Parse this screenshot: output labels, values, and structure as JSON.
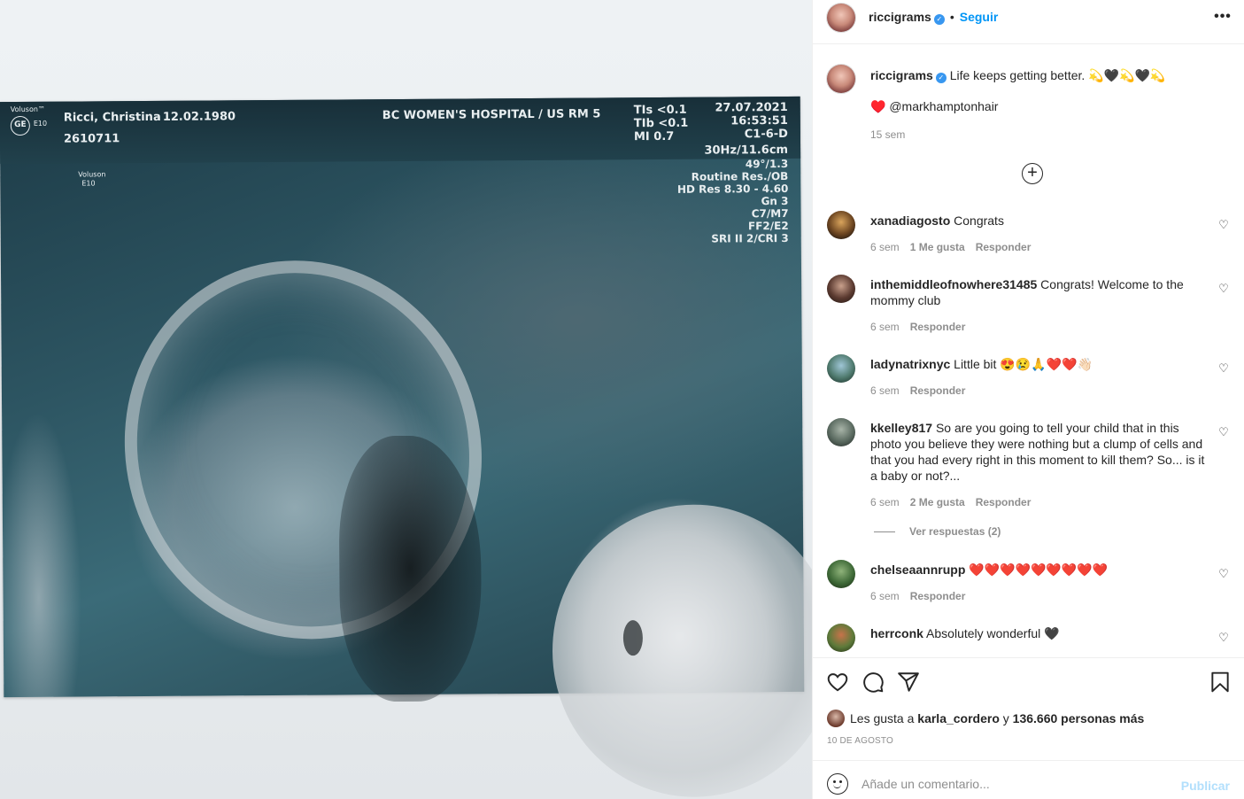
{
  "scan": {
    "brand": "Voluson™",
    "brand_model": "E10",
    "logo": "GE",
    "patient_name": "Ricci, Christina",
    "patient_dob": "12.02.1980",
    "patient_id": "2610711",
    "device_small": "Voluson",
    "device_small_model": "E10",
    "hospital": "BC WOMEN'S HOSPITAL / US RM 5",
    "tis": "TIs <0.1",
    "tib": "TIb <0.1",
    "mi": "MI 0.7",
    "date": "27.07.2021",
    "time": "16:53:51",
    "probe": "C1-6-D",
    "freq": "30Hz/11.6cm",
    "angle": "49°/1.3",
    "mode": "Routine Res./OB",
    "hd_res": "HD Res 8.30 - 4.60",
    "gn": "Gn  3",
    "c": "C7/M7",
    "ff": "FF2/E2",
    "sri": "SRI II 2/CRI 3"
  },
  "header": {
    "username": "riccigrams",
    "separator": "•",
    "follow_label": "Seguir",
    "more_icon": "more-horizontal-icon",
    "more_label": "•••"
  },
  "caption": {
    "username": "riccigrams",
    "text": "Life keeps getting better. 💫🖤💫🖤💫",
    "tag_line": "♥️ @markhamptonhair",
    "time": "15 sem"
  },
  "load_more_icon": "plus-circle-icon",
  "comments": [
    {
      "username": "xanadiagosto",
      "text": "Congrats",
      "time": "6 sem",
      "likes": "1 Me gusta",
      "reply": "Responder"
    },
    {
      "username": "inthemiddleofnowhere31485",
      "text": "Congrats! Welcome to the mommy club",
      "time": "6 sem",
      "reply": "Responder"
    },
    {
      "username": "ladynatrixnyc",
      "text": "Little bit 😍😢🙏❤️❤️👋🏻",
      "time": "6 sem",
      "reply": "Responder"
    },
    {
      "username": "kkelley817",
      "text": "So are you going to tell your child that in this photo you believe they were nothing but a clump of cells and that you had every right in this moment to kill them? So... is it a baby or not?...",
      "time": "6 sem",
      "likes": "2 Me gusta",
      "reply": "Responder",
      "view_replies": "Ver respuestas (2)"
    },
    {
      "username": "chelseaannrupp",
      "text": "❤️❤️❤️❤️❤️❤️❤️❤️❤️",
      "time": "6 sem",
      "reply": "Responder"
    },
    {
      "username": "herrconk",
      "text": "Absolutely wonderful 🖤"
    }
  ],
  "actions": {
    "like_icon": "heart-icon",
    "comment_icon": "comment-icon",
    "share_icon": "send-icon",
    "save_icon": "bookmark-icon"
  },
  "likes": {
    "prefix": "Les gusta a",
    "user": "karla_cordero",
    "middle": "y",
    "count": "136.660 personas más"
  },
  "post_date": "10 DE AGOSTO",
  "comment_box": {
    "emoji_icon": "emoji-icon",
    "placeholder": "Añade un comentario...",
    "publish_label": "Publicar"
  },
  "colors": {
    "link": "#0095f6",
    "publish_disabled": "#b2dffc",
    "muted": "#8e8e8e",
    "text": "#262626",
    "verified": "#3897f0"
  }
}
